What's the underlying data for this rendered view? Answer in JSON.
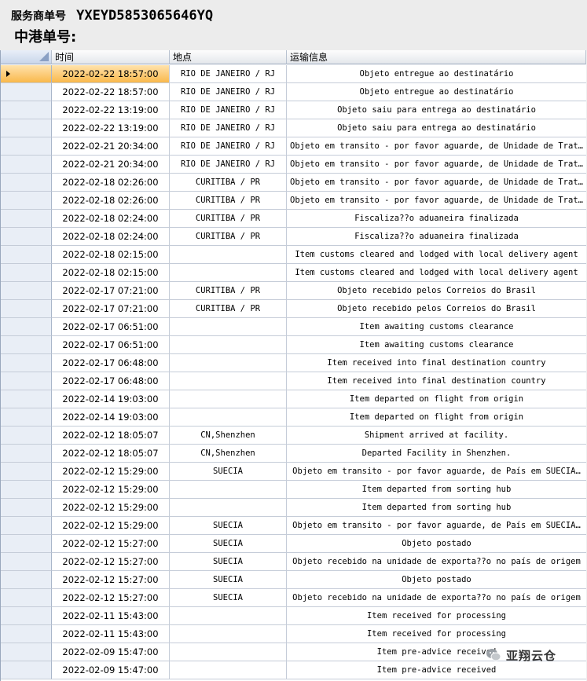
{
  "header": {
    "service_label": "服务商单号",
    "service_number": "YXEYD5853065646YQ",
    "zhonggang_label": "中港单号:"
  },
  "table": {
    "columns": [
      "时间",
      "地点",
      "运输信息"
    ],
    "rows": [
      [
        "2022-02-22 18:57:00",
        "RIO DE JANEIRO / RJ",
        "Objeto entregue ao destinatário"
      ],
      [
        "2022-02-22 18:57:00",
        "RIO DE JANEIRO / RJ",
        "Objeto entregue ao destinatário"
      ],
      [
        "2022-02-22 13:19:00",
        "RIO DE JANEIRO / RJ",
        "Objeto saiu para entrega ao destinatário"
      ],
      [
        "2022-02-22 13:19:00",
        "RIO DE JANEIRO / RJ",
        "Objeto saiu para entrega ao destinatário"
      ],
      [
        "2022-02-21 20:34:00",
        "RIO DE JANEIRO / RJ",
        "Objeto em transito - por favor aguarde, de Unidade de Trat…"
      ],
      [
        "2022-02-21 20:34:00",
        "RIO DE JANEIRO / RJ",
        "Objeto em transito - por favor aguarde, de Unidade de Trat…"
      ],
      [
        "2022-02-18 02:26:00",
        "CURITIBA / PR",
        "Objeto em transito - por favor aguarde, de Unidade de Trat…"
      ],
      [
        "2022-02-18 02:26:00",
        "CURITIBA / PR",
        "Objeto em transito - por favor aguarde, de Unidade de Trat…"
      ],
      [
        "2022-02-18 02:24:00",
        "CURITIBA / PR",
        "Fiscaliza??o aduaneira finalizada"
      ],
      [
        "2022-02-18 02:24:00",
        "CURITIBA / PR",
        "Fiscaliza??o aduaneira finalizada"
      ],
      [
        "2022-02-18 02:15:00",
        "",
        "Item customs cleared and lodged with local delivery agent"
      ],
      [
        "2022-02-18 02:15:00",
        "",
        "Item customs cleared and lodged with local delivery agent"
      ],
      [
        "2022-02-17 07:21:00",
        "CURITIBA / PR",
        "Objeto recebido pelos Correios do Brasil"
      ],
      [
        "2022-02-17 07:21:00",
        "CURITIBA / PR",
        "Objeto recebido pelos Correios do Brasil"
      ],
      [
        "2022-02-17 06:51:00",
        "",
        "Item awaiting customs clearance"
      ],
      [
        "2022-02-17 06:51:00",
        "",
        "Item awaiting customs clearance"
      ],
      [
        "2022-02-17 06:48:00",
        "",
        "Item received into final destination country"
      ],
      [
        "2022-02-17 06:48:00",
        "",
        "Item received into final destination country"
      ],
      [
        "2022-02-14 19:03:00",
        "",
        "Item departed on flight from origin"
      ],
      [
        "2022-02-14 19:03:00",
        "",
        "Item departed on flight from origin"
      ],
      [
        "2022-02-12 18:05:07",
        "CN,Shenzhen",
        "Shipment arrived at facility."
      ],
      [
        "2022-02-12 18:05:07",
        "CN,Shenzhen",
        "Departed Facility in Shenzhen."
      ],
      [
        "2022-02-12 15:29:00",
        "SUECIA",
        "Objeto em transito - por favor aguarde, de País em SUECIA…"
      ],
      [
        "2022-02-12 15:29:00",
        "",
        "Item departed from sorting hub"
      ],
      [
        "2022-02-12 15:29:00",
        "",
        "Item departed from sorting hub"
      ],
      [
        "2022-02-12 15:29:00",
        "SUECIA",
        "Objeto em transito - por favor aguarde, de País em SUECIA…"
      ],
      [
        "2022-02-12 15:27:00",
        "SUECIA",
        "Objeto postado"
      ],
      [
        "2022-02-12 15:27:00",
        "SUECIA",
        "Objeto recebido na unidade de exporta??o no país de origem"
      ],
      [
        "2022-02-12 15:27:00",
        "SUECIA",
        "Objeto postado"
      ],
      [
        "2022-02-12 15:27:00",
        "SUECIA",
        "Objeto recebido na unidade de exporta??o no país de origem"
      ],
      [
        "2022-02-11 15:43:00",
        "",
        "Item received for processing"
      ],
      [
        "2022-02-11 15:43:00",
        "",
        "Item received for processing"
      ],
      [
        "2022-02-09 15:47:00",
        "",
        "Item pre-advice received"
      ],
      [
        "2022-02-09 15:47:00",
        "",
        "Item pre-advice received"
      ]
    ]
  },
  "watermark": {
    "text": "亚翔云仓",
    "icon": "wechat-icon"
  },
  "colors": {
    "selected_row": "#f9b84c",
    "indicator": "#e9eef6",
    "grid_line": "#c5ccd8"
  }
}
